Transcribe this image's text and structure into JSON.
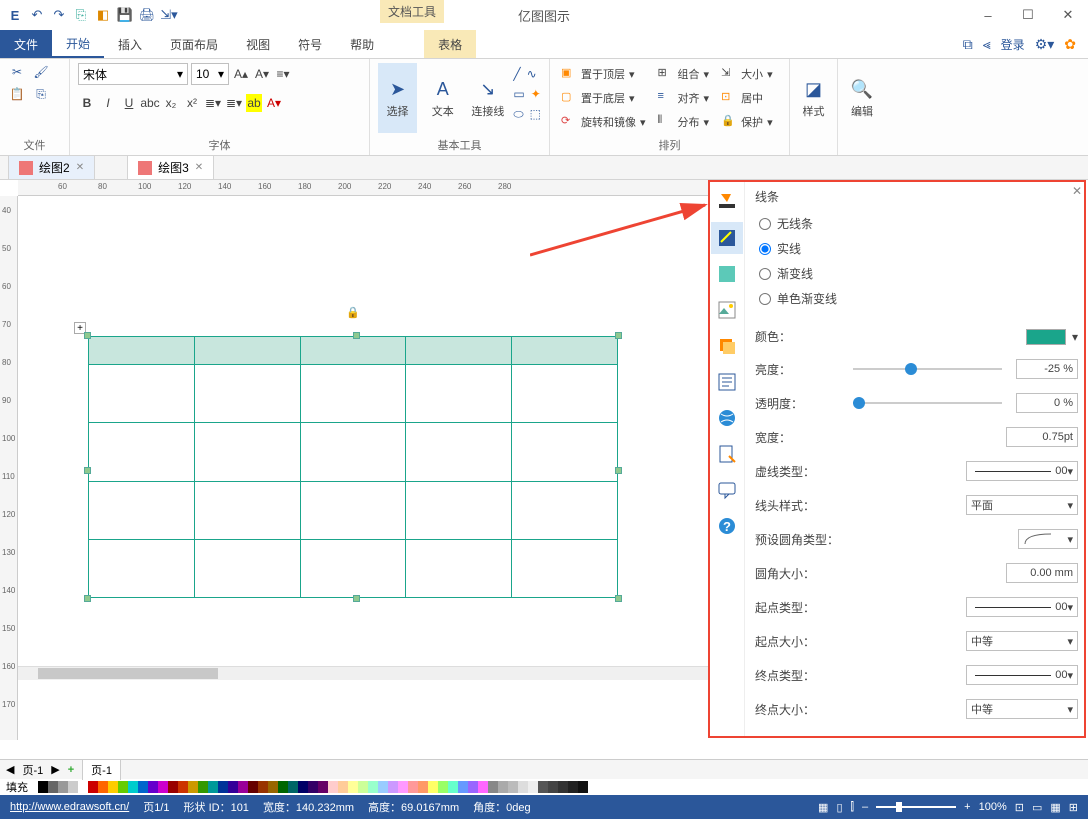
{
  "app_title": "亿图图示",
  "tool_context": "文档工具",
  "tool_context_tab": "表格",
  "qat": [
    "save",
    "undo",
    "redo",
    "new",
    "shape",
    "save2",
    "print",
    "export"
  ],
  "window_controls": {
    "min": "–",
    "max": "☐",
    "close": "✕"
  },
  "tabs": {
    "file": "文件",
    "items": [
      "开始",
      "插入",
      "页面布局",
      "视图",
      "符号",
      "帮助"
    ],
    "active": "开始"
  },
  "ribbon_right": {
    "login": "登录"
  },
  "ribbon": {
    "groups": {
      "file": "文件",
      "font": "字体",
      "basic_tools": "基本工具",
      "arrange": "排列",
      "style": "样式",
      "edit": "编辑"
    },
    "font": {
      "name": "宋体",
      "size": "10"
    },
    "basic": {
      "select": "选择",
      "text": "文本",
      "connector": "连接线"
    },
    "arrange": {
      "bring_front": "置于顶层",
      "send_back": "置于底层",
      "rotate": "旋转和镜像",
      "group": "组合",
      "align": "对齐",
      "distribute": "分布",
      "size": "大小",
      "center": "居中",
      "protect": "保护"
    }
  },
  "doc_tabs": [
    {
      "label": "绘图2",
      "active": true
    },
    {
      "label": "绘图3",
      "active": false
    }
  ],
  "ruler_h": [
    60,
    80,
    100,
    120,
    140,
    160,
    180,
    200,
    220,
    240,
    260,
    280
  ],
  "ruler_v": [
    40,
    50,
    60,
    70,
    80,
    90,
    100,
    110,
    120,
    130,
    140,
    150,
    160,
    170
  ],
  "right_panel": {
    "title": "线条",
    "line_types": {
      "none": "无线条",
      "solid": "实线",
      "gradient": "渐变线",
      "single_gradient": "单色渐变线",
      "selected": "solid"
    },
    "props": {
      "color": {
        "label": "颜色：",
        "value": "#1aa58b"
      },
      "brightness": {
        "label": "亮度：",
        "value": "-25 %"
      },
      "transparency": {
        "label": "透明度：",
        "value": "0 %"
      },
      "width": {
        "label": "宽度：",
        "value": "0.75pt"
      },
      "dash": {
        "label": "虚线类型：",
        "value": "00"
      },
      "cap": {
        "label": "线头样式：",
        "value": "平面"
      },
      "corner_preset": {
        "label": "预设圆角类型：",
        "value": ""
      },
      "corner_size": {
        "label": "圆角大小：",
        "value": "0.00 mm"
      },
      "start_type": {
        "label": "起点类型：",
        "value": "00"
      },
      "start_size": {
        "label": "起点大小：",
        "value": "中等"
      },
      "end_type": {
        "label": "终点类型：",
        "value": "00"
      },
      "end_size": {
        "label": "终点大小：",
        "value": "中等"
      }
    }
  },
  "page_bar": {
    "nav": "页-1",
    "tab": "页-1"
  },
  "color_bar_label": "填充",
  "status": {
    "url": "http://www.edrawsoft.cn/",
    "page": "页1/1",
    "shape_id": "形状 ID：101",
    "width": "宽度：140.232mm",
    "height": "高度：69.0167mm",
    "angle": "角度：0deg",
    "zoom": "100%"
  },
  "colors_palette": [
    "#000",
    "#666",
    "#999",
    "#ccc",
    "#fff",
    "#c00",
    "#f60",
    "#fc0",
    "#6c0",
    "#0cc",
    "#06c",
    "#60c",
    "#c0c",
    "#900",
    "#c30",
    "#c90",
    "#390",
    "#099",
    "#039",
    "#309",
    "#909",
    "#600",
    "#930",
    "#960",
    "#060",
    "#066",
    "#006",
    "#306",
    "#606",
    "#fcc",
    "#fc9",
    "#ff9",
    "#cf9",
    "#9fc",
    "#9cf",
    "#c9f",
    "#f9f",
    "#f99",
    "#f96",
    "#ff6",
    "#9f6",
    "#6fc",
    "#69f",
    "#96f",
    "#f6f",
    "#888",
    "#aaa",
    "#bbb",
    "#ddd",
    "#eee",
    "#555",
    "#444",
    "#333",
    "#222",
    "#111"
  ]
}
